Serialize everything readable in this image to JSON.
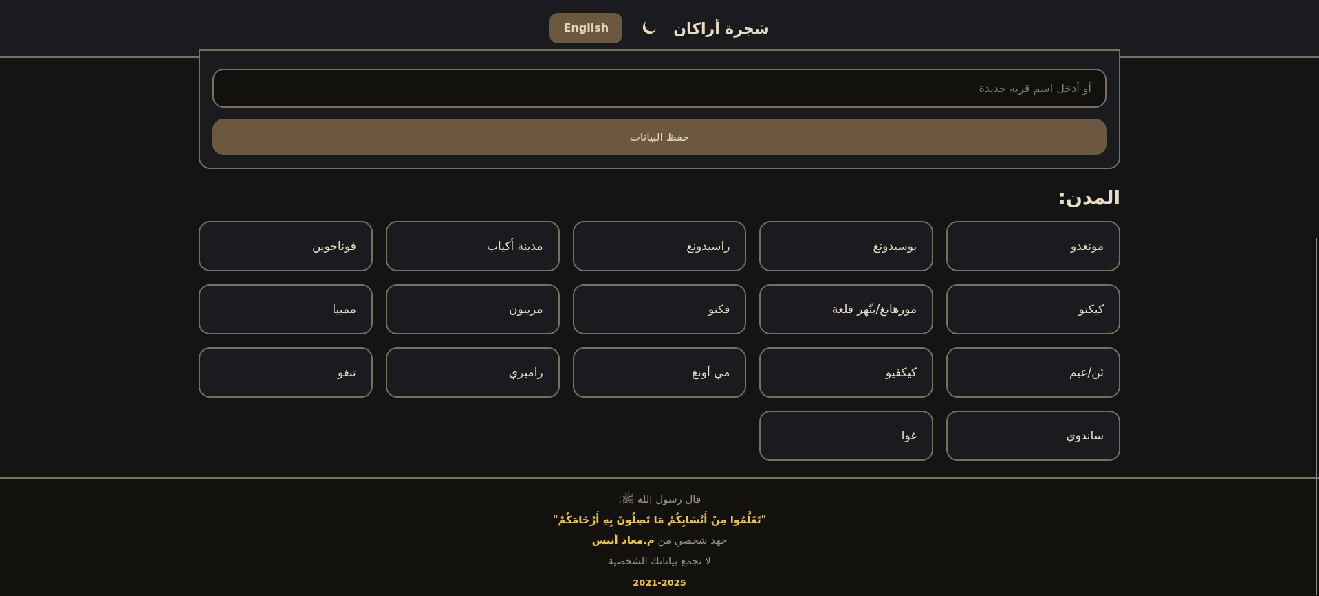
{
  "header": {
    "title": "شجرة أراكان",
    "language_button": "English"
  },
  "form": {
    "village_field": {
      "placeholder": "أو أدخل اسم قرية جديدة"
    },
    "save_button": "حفظ البيانات"
  },
  "cities": {
    "heading": "المدن:",
    "items": [
      "مونغدو",
      "بوسيدونغ",
      "راسيدونغ",
      "مدينة أكياب",
      "فوناجوين",
      "كيكتو",
      "مورهانغ/بتّهر قلعة",
      "فكتو",
      "مريبون",
      "ممبيا",
      "ئن/عيم",
      "كيكفيو",
      "مي أونغ",
      "رامبري",
      "تنغو",
      "ساندوي",
      "غوا"
    ]
  },
  "footer": {
    "intro": "قال رسول الله ﷺ:",
    "quote": "\"تَعَلَّمُوا مِنْ أَنْسَابِكُمْ مَا تَصِلُونَ بِهِ أَرْحَامَكُمْ\"",
    "credit": "جهد شخصي من **م.معاذ أنيس**",
    "privacy": "لا نجمع بياناتك الشخصية",
    "years": "2021-2025"
  }
}
